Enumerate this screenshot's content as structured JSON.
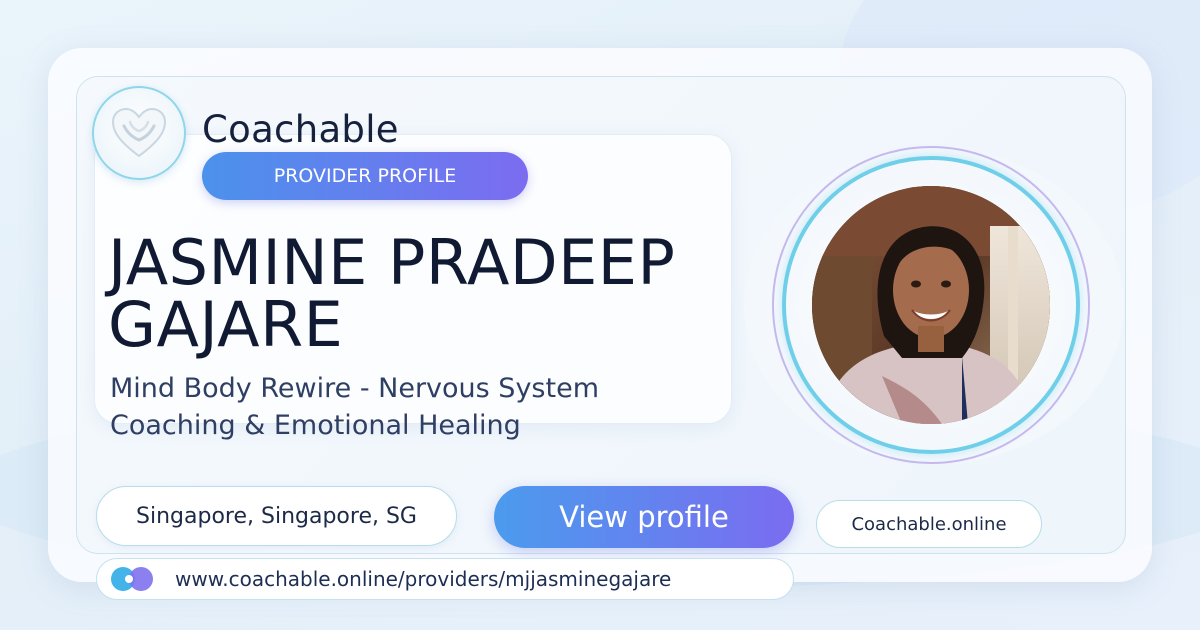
{
  "brand": {
    "name": "Coachable",
    "logo_icon": "heart-hands-icon"
  },
  "badge": {
    "label": "PROVIDER PROFILE"
  },
  "provider": {
    "name": "JASMINE PRADEEP GAJARE",
    "tagline": "Mind Body Rewire - Nervous System Coaching & Emotional Healing",
    "photo_icon": "profile-photo"
  },
  "location": {
    "label": "Singapore, Singapore, SG"
  },
  "cta": {
    "label": "View profile"
  },
  "site": {
    "label": "Coachable.online"
  },
  "url": {
    "text": "www.coachable.online/providers/mjjasminegajare",
    "icon": "link-circles-icon"
  },
  "colors": {
    "accent_start": "#4b92ec",
    "accent_end": "#7c6cf0",
    "ring": "#6fcfe9",
    "text_dark": "#111a33"
  }
}
